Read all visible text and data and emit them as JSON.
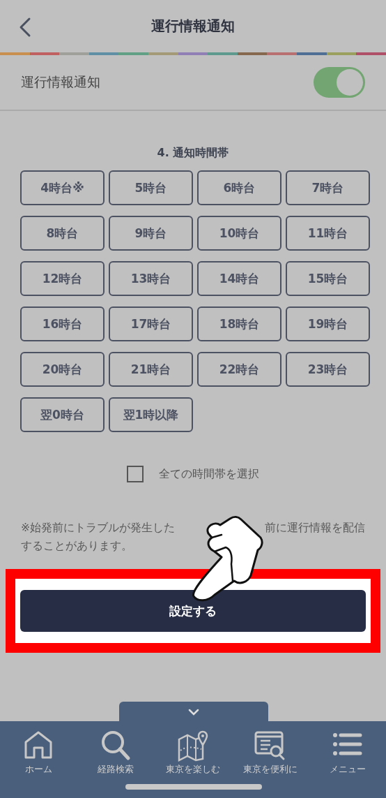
{
  "header": {
    "title": "運行情報通知"
  },
  "toggle_row": {
    "label": "運行情報通知",
    "on": true
  },
  "section": {
    "title": "4. 通知時間帯",
    "hours": [
      "4時台※",
      "5時台",
      "6時台",
      "7時台",
      "8時台",
      "9時台",
      "10時台",
      "11時台",
      "12時台",
      "13時台",
      "14時台",
      "15時台",
      "16時台",
      "17時台",
      "18時台",
      "19時台",
      "20時台",
      "21時台",
      "22時台",
      "23時台",
      "翌0時台",
      "翌1時以降"
    ],
    "select_all": {
      "label": "全ての時間帯を選択",
      "checked": false
    },
    "note_parts": [
      "※始発前にトラブルが発生した",
      "前に運行情報を配信",
      "することがあります。"
    ]
  },
  "submit_button": "設定する",
  "bottom_nav": {
    "items": [
      {
        "kind": "home",
        "label": "ホーム"
      },
      {
        "kind": "search",
        "label": "経路検索"
      },
      {
        "kind": "map",
        "label": "東京を楽しむ"
      },
      {
        "kind": "doc-search",
        "label": "東京を便利に"
      },
      {
        "kind": "menu",
        "label": "メニュー"
      }
    ]
  }
}
